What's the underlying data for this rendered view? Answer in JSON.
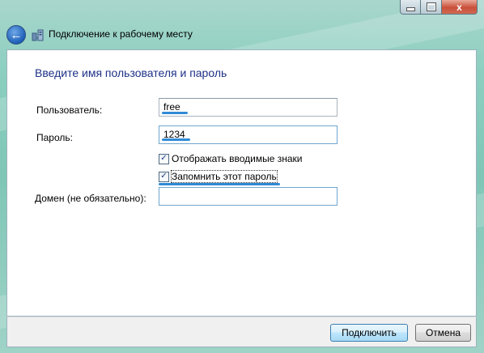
{
  "window": {
    "title": "Подключение к рабочему месту"
  },
  "caption_buttons": {
    "close": "x"
  },
  "back_button": {
    "glyph": "←"
  },
  "heading": "Введите имя пользователя и пароль",
  "form": {
    "username_label": "Пользователь:",
    "username_value": "free",
    "password_label": "Пароль:",
    "password_value": "1234",
    "show_chars_label": "Отображать вводимые знаки",
    "show_chars_checked": true,
    "remember_label": "Запомнить этот пароль",
    "remember_checked": true,
    "domain_label": "Домен (не обязательно):",
    "domain_value": ""
  },
  "buttons": {
    "connect": "Подключить",
    "cancel": "Отмена"
  },
  "icons": {
    "back": "back-arrow-icon",
    "network": "network-connection-icon",
    "check": "checkmark-icon"
  },
  "colors": {
    "heading": "#1e3287",
    "accent_underline": "#2f8ad6",
    "window_glass": "#8ccfc0",
    "close_button": "#c9503a"
  }
}
